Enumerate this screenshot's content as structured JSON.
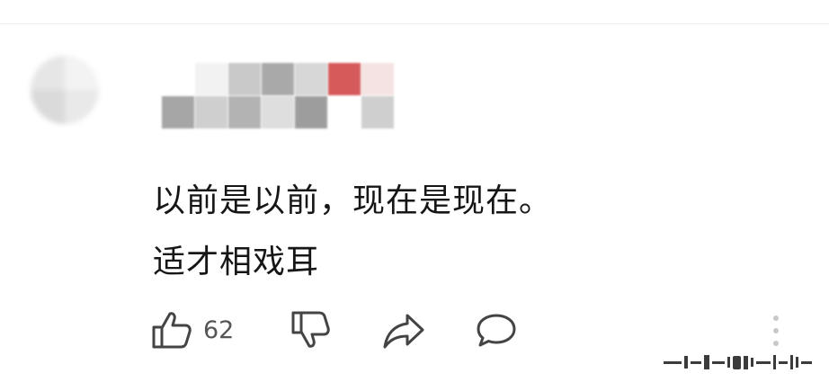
{
  "comment": {
    "lines": [
      "以前是以前，现在是现在。",
      "适才相戏耳"
    ],
    "like_count": "62"
  },
  "author": {
    "avatar_colors": [
      "#e6e6e6",
      "#f3f3f3",
      "#dadada",
      "#e9e9e9"
    ],
    "name_mosaic": [
      "#ffffff",
      "#f2f2f2",
      "#c9c9c9",
      "#a9a9a9",
      "#d7d7d7",
      "#d65a5a",
      "#f5e3e3",
      "#a6a6a6",
      "#cfcfcf",
      "#b3b3b3",
      "#dedede",
      "#9d9d9d",
      "#ffffff",
      "#cfcfcf"
    ]
  },
  "icons": {
    "like": "thumbs-up-icon",
    "dislike": "thumbs-down-icon",
    "share": "share-icon",
    "comment": "comment-bubble-icon",
    "more": "more-vertical-icon"
  },
  "colors": {
    "text": "#161616",
    "icon": "#444444",
    "count": "#555555"
  }
}
